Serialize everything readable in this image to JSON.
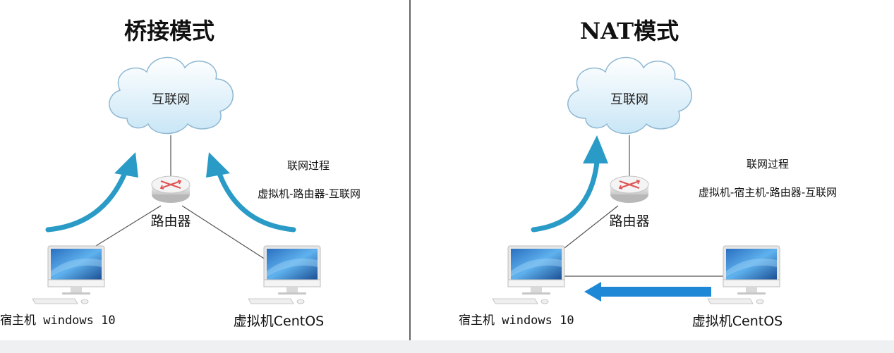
{
  "left_panel": {
    "title": "桥接模式",
    "cloud_label": "互联网",
    "router_label": "路由器",
    "host_label": "宿主机 windows 10",
    "vm_label": "虚拟机CentOS",
    "note_heading": "联网过程",
    "note_path": "虚拟机-路由器-互联网"
  },
  "right_panel": {
    "title": "NAT模式",
    "cloud_label": "互联网",
    "router_label": "路由器",
    "host_label": "宿主机 windows 10",
    "vm_label": "虚拟机CentOS",
    "note_heading": "联网过程",
    "note_path": "虚拟机-宿主机-路由器-互联网"
  },
  "colors": {
    "arrow_teal": "#2a9bc6",
    "arrow_blue": "#1e88d6",
    "divider": "#333333",
    "line": "#555555"
  },
  "icons": [
    "cloud-icon",
    "router-icon",
    "computer-icon",
    "keyboard-icon"
  ]
}
